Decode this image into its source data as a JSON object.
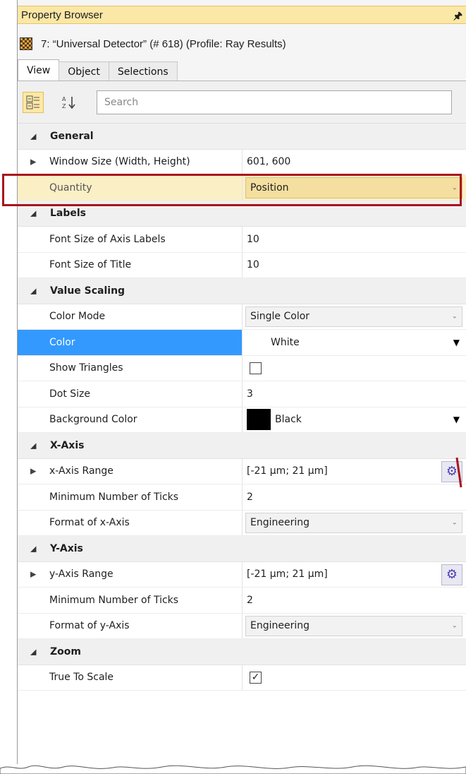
{
  "window": {
    "title": "Property Browser",
    "pin_icon": "pin-icon"
  },
  "object_line": {
    "text": "7: “Universal Detector” (# 618) (Profile: Ray Results)"
  },
  "tabs": [
    {
      "label": "View",
      "active": true
    },
    {
      "label": "Object",
      "active": false
    },
    {
      "label": "Selections",
      "active": false
    }
  ],
  "toolbar": {
    "search_placeholder": "Search"
  },
  "rows": [
    {
      "type": "category",
      "label": "General"
    },
    {
      "type": "prop",
      "label": "Window Size (Width, Height)",
      "expandable": true,
      "value": "601, 600"
    },
    {
      "type": "prop",
      "label": "Quantity",
      "value": "Position",
      "editor": "combo"
    },
    {
      "type": "category",
      "label": "Labels"
    },
    {
      "type": "prop",
      "label": "Font Size of Axis Labels",
      "value": "10"
    },
    {
      "type": "prop",
      "label": "Font Size of Title",
      "value": "10"
    },
    {
      "type": "category",
      "label": "Value Scaling"
    },
    {
      "type": "prop",
      "label": "Color Mode",
      "value": "Single Color",
      "editor": "combo"
    },
    {
      "type": "prop",
      "label": "Color",
      "value": "White",
      "editor": "dropdown"
    },
    {
      "type": "prop",
      "label": "Show Triangles",
      "editor": "checkbox",
      "checked": false
    },
    {
      "type": "prop",
      "label": "Dot Size",
      "value": "3"
    },
    {
      "type": "prop",
      "label": "Background Color",
      "value": "Black",
      "editor": "color"
    },
    {
      "type": "category",
      "label": "X-Axis"
    },
    {
      "type": "prop",
      "label": "x-Axis Range",
      "expandable": true,
      "value": "[-21 µm; 21 µm]",
      "editor": "gear"
    },
    {
      "type": "prop",
      "label": "Minimum Number of Ticks",
      "value": "2"
    },
    {
      "type": "prop",
      "label": "Format of x-Axis",
      "value": "Engineering",
      "editor": "combo"
    },
    {
      "type": "category",
      "label": "Y-Axis"
    },
    {
      "type": "prop",
      "label": "y-Axis Range",
      "expandable": true,
      "value": "[-21 µm; 21 µm]",
      "editor": "gear"
    },
    {
      "type": "prop",
      "label": "Minimum Number of Ticks",
      "value": "2"
    },
    {
      "type": "prop",
      "label": "Format of y-Axis",
      "value": "Engineering",
      "editor": "combo"
    },
    {
      "type": "category",
      "label": "Zoom"
    },
    {
      "type": "prop",
      "label": "True To Scale",
      "editor": "checkbox",
      "checked": true
    }
  ],
  "colors": {
    "title_bar": "#fbe7a6",
    "selection": "#3399ff",
    "highlight_annotation": "#a8141e"
  }
}
